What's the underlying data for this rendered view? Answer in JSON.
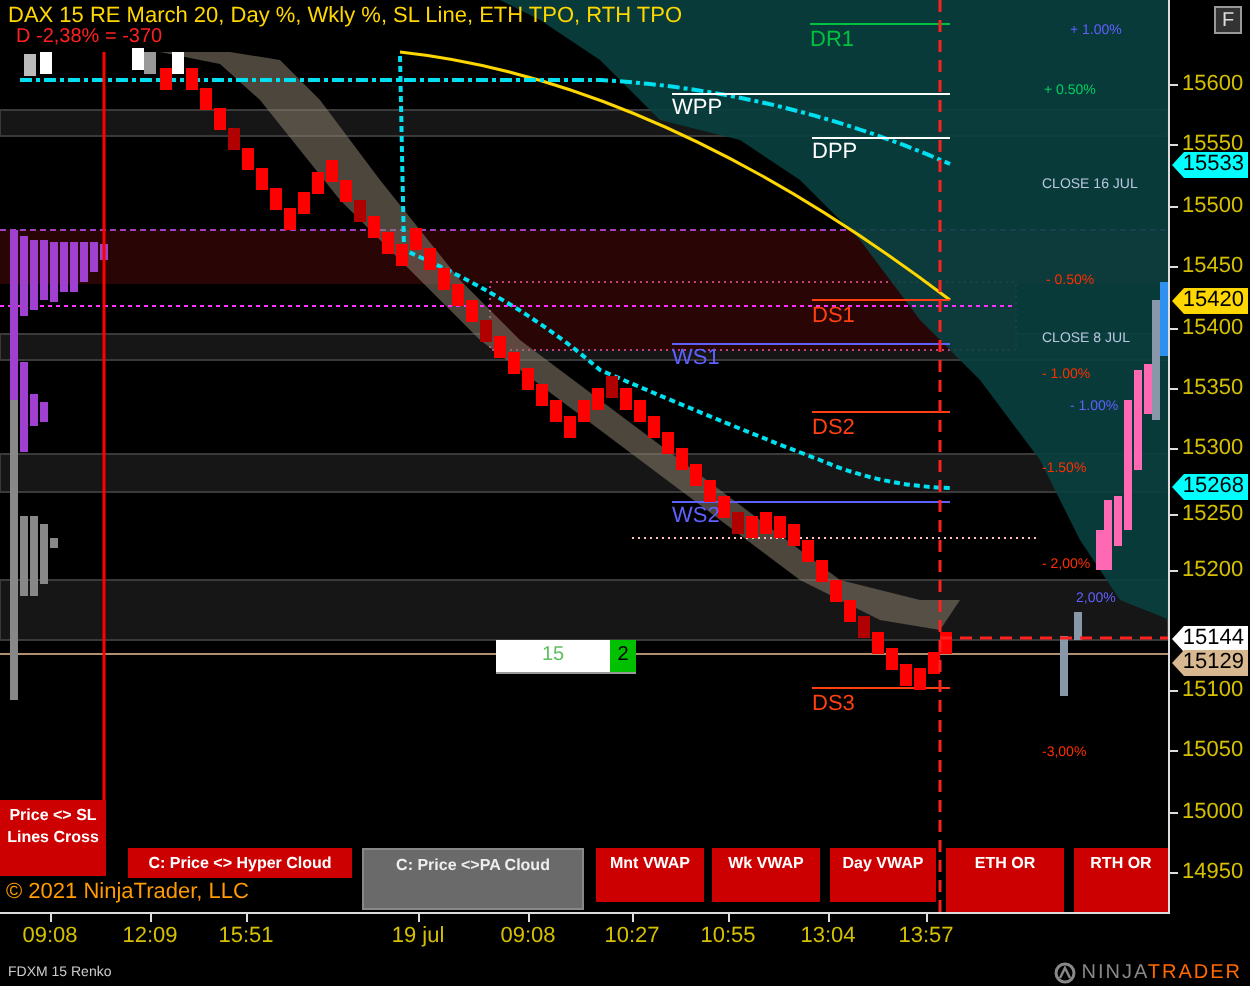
{
  "chart": {
    "title": "DAX 15 RE March 20, Day %, Wkly %, SL Line, ETH TPO, RTH TPO",
    "change": "D -2,38% = -370",
    "copyright": "© 2021 NinjaTrader, LLC",
    "levels": [
      {
        "label": "DR1",
        "color": "#00c040"
      },
      {
        "label": "WPP",
        "color": "#ffffff"
      },
      {
        "label": "DPP",
        "color": "#ffffff"
      },
      {
        "label": "DS1",
        "color": "#ff4010"
      },
      {
        "label": "WS1",
        "color": "#6060ff"
      },
      {
        "label": "DS2",
        "color": "#ff4010"
      },
      {
        "label": "WS2",
        "color": "#6060ff"
      },
      {
        "label": "DS3",
        "color": "#ff4010"
      }
    ],
    "percent_labels": [
      {
        "text": "+ 1.00%",
        "color": "#6060ff"
      },
      {
        "text": "+ 0.50%",
        "color": "#00d060"
      },
      {
        "text": "CLOSE 16 JUL",
        "color": "#b8c8e0"
      },
      {
        "text": "- 0.50%",
        "color": "#ff3000"
      },
      {
        "text": "CLOSE 8 JUL",
        "color": "#b8c8e0"
      },
      {
        "text": "- 1.00%",
        "color": "#ff3000"
      },
      {
        "text": "- 1.00%",
        "color": "#6060ff"
      },
      {
        "text": "-1.50%",
        "color": "#ff3000"
      },
      {
        "text": "- 2,00%",
        "color": "#ff3000"
      },
      {
        "text": "2,00%",
        "color": "#6060ff"
      },
      {
        "text": "-3,00%",
        "color": "#ff3000"
      }
    ],
    "brick_counter": {
      "value": "15",
      "count": "2"
    },
    "buttons": [
      {
        "label": "Price <> SL Lines Cross",
        "on": true
      },
      {
        "label": "C: Price <> Hyper Cloud",
        "on": true
      },
      {
        "label": "C: Price <>PA Cloud",
        "on": false
      },
      {
        "label": "Mnt VWAP",
        "on": true
      },
      {
        "label": "Wk VWAP",
        "on": true
      },
      {
        "label": "Day VWAP",
        "on": true
      },
      {
        "label": "ETH OR",
        "on": true
      },
      {
        "label": "RTH OR",
        "on": true
      }
    ]
  },
  "panel_button": "F",
  "price_axis": {
    "labels": [
      "15600",
      "15550",
      "15500",
      "15450",
      "15400",
      "15350",
      "15300",
      "15250",
      "15200",
      "15100",
      "15050",
      "15000",
      "14950"
    ],
    "markers": [
      {
        "text": "15533",
        "color": "#00ffff"
      },
      {
        "text": "15420",
        "color": "#ffd700"
      },
      {
        "text": "15268",
        "color": "#00ffff"
      },
      {
        "text": "15144",
        "color": "#ffffff"
      },
      {
        "text": "15129",
        "color": "#d8b890"
      }
    ]
  },
  "time_axis": {
    "labels": [
      "09:08",
      "12:09",
      "15:51",
      "19 jul",
      "09:08",
      "10:27",
      "10:55",
      "13:04",
      "13:57"
    ]
  },
  "instrument": "FDXM 15 Renko",
  "logo": {
    "first": "NINJA",
    "second": "TRADER"
  }
}
